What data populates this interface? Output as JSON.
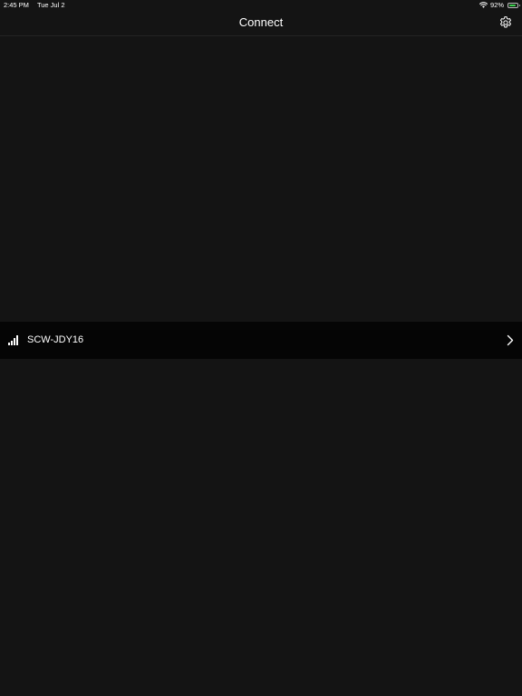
{
  "status_bar": {
    "time": "2:45 PM",
    "date": "Tue Jul 2",
    "battery_percent_label": "92%",
    "battery_level": 0.92,
    "icons": [
      "wifi-icon",
      "battery-icon"
    ]
  },
  "nav": {
    "title": "Connect",
    "settings_icon": "gear-icon"
  },
  "devices": [
    {
      "name": "SCW-JDY16",
      "signal_icon": "signal-strength-icon",
      "disclosure_icon": "chevron-right-icon"
    }
  ],
  "colors": {
    "background": "#141414",
    "row_background": "#050505",
    "text": "#ffffff",
    "battery_fill": "#3ccf4e"
  }
}
